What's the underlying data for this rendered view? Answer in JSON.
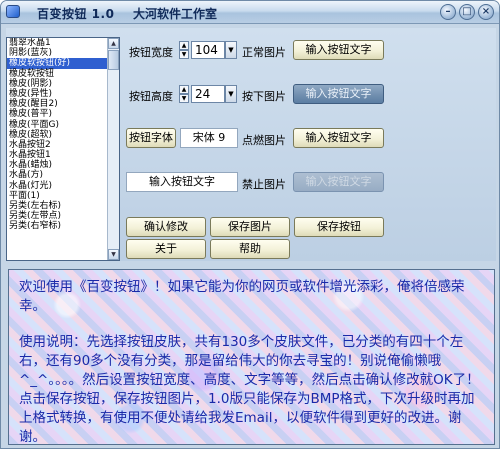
{
  "window": {
    "title": "百变按钮 1.0",
    "company": "大河软件工作室",
    "minimize_icon": "minimize-icon",
    "maximize_icon": "maximize-icon",
    "close_icon": "close-icon"
  },
  "skin_list": {
    "items": [
      "翡翠水晶1",
      "阴影(蓝灰)",
      "橡皮软按钮(好)",
      "橡皮软按钮",
      "橡皮(阴影)",
      "橡皮(异性)",
      "橡皮(醒目2)",
      "橡皮(普平)",
      "橡皮(平面G)",
      "橡皮(超软)",
      "水晶按钮2",
      "水晶按钮1",
      "水晶(蜡烛)",
      "水晶(方)",
      "水晶(灯光)",
      "平面(1)",
      "另类(左右标)",
      "另类(左带点)",
      "另类(右窄标)"
    ],
    "selected_index": 2
  },
  "controls": {
    "width_label": "按钮宽度",
    "width_value": "104",
    "height_label": "按钮高度",
    "height_value": "24",
    "font_button": "按钮字体",
    "font_value": "宋体 9",
    "preview_text_value": "输入按钮文字",
    "normal_label": "正常图片",
    "pressed_label": "按下图片",
    "hover_label": "点燃图片",
    "disabled_label": "禁止图片",
    "preview_button_label": "输入按钮文字"
  },
  "actions": {
    "confirm": "确认修改",
    "save_image": "保存图片",
    "save_button": "保存按钮",
    "about": "关于",
    "help": "帮助"
  },
  "description": {
    "para1": "欢迎使用《百变按钮》！如果它能为你的网页或软件增光添彩，俺将倍感荣幸。",
    "para2": "使用说明：先选择按钮皮肤，共有130多个皮肤文件，已分类的有四十个左右，还有90多个没有分类，那是留给伟大的你去寻宝的！别说俺偷懒哦^_^。。。。然后设置按钮宽度、高度、文字等等，然后点击确认修改就OK了！点击保存按钮，保存按钮图片，1.0版只能保存为BMP格式，下次升级时再加上格式转换，有使用不便处请给我发Email，以便软件得到更好的改进。谢谢。"
  }
}
